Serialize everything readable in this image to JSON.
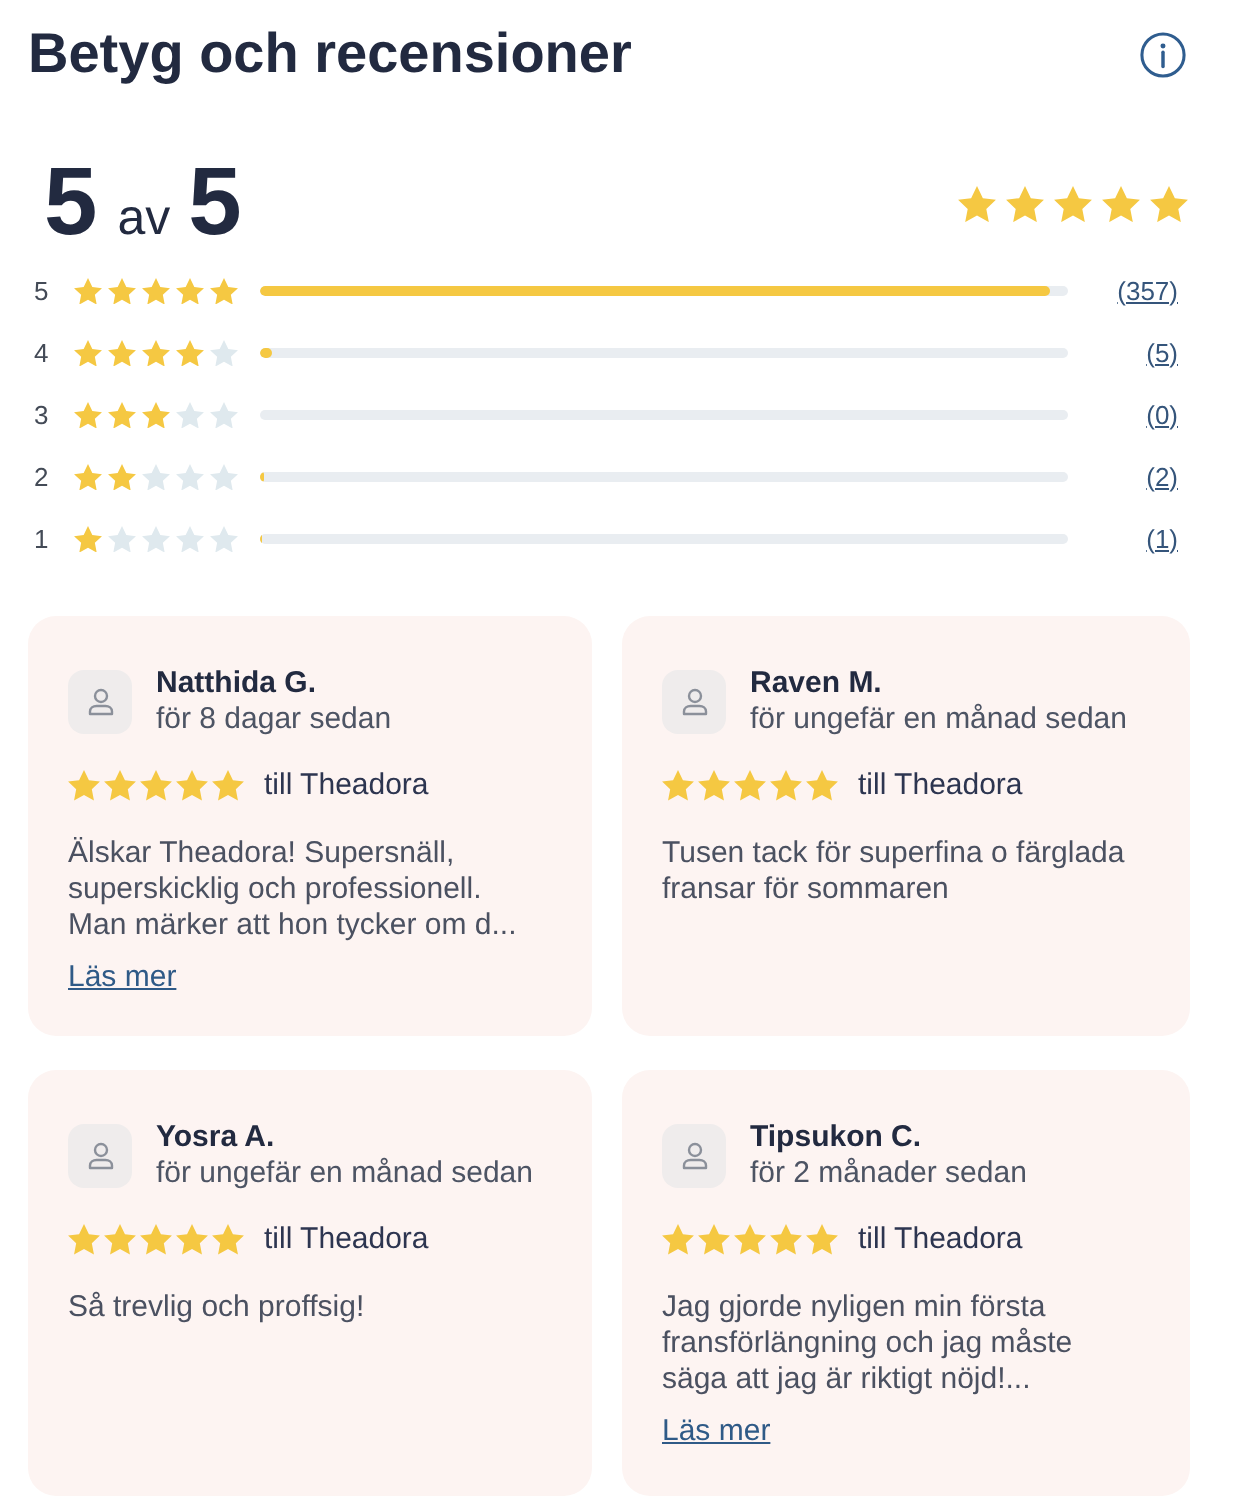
{
  "header": {
    "title": "Betyg och recensioner"
  },
  "summary": {
    "score": "5",
    "of_label": "av",
    "max": "5",
    "stars": 5
  },
  "distribution": [
    {
      "label": "5",
      "stars": 5,
      "level": 0.978,
      "count": "(357)"
    },
    {
      "label": "4",
      "stars": 4,
      "level": 0.015,
      "count": "(5)"
    },
    {
      "label": "3",
      "stars": 3,
      "count": "(0)"
    },
    {
      "label": "2",
      "stars": 2,
      "level": 0.006,
      "count": "(2)"
    },
    {
      "label": "1",
      "stars": 1,
      "level": 0.003,
      "count": "(1)"
    }
  ],
  "reviews": [
    {
      "name": "Natthida G.",
      "time": "för 8 dagar sedan",
      "stars": 5,
      "target": "till Theadora",
      "text": "Älskar Theadora! Supersnäll, superskicklig och professionell. Man märker att hon tycker om d...",
      "read_more": "Läs mer"
    },
    {
      "name": "Raven M.",
      "time": "för ungefär en månad sedan",
      "stars": 5,
      "target": "till Theadora",
      "text": "Tusen tack för superfina o färglada fransar för sommaren"
    },
    {
      "name": "Yosra A.",
      "time": "för ungefär en månad sedan",
      "stars": 5,
      "target": "till Theadora",
      "text": "Så trevlig och proffsig!"
    },
    {
      "name": "Tipsukon C.",
      "time": "för 2 månader sedan",
      "stars": 5,
      "target": "till Theadora",
      "text": "Jag gjorde nyligen min första fransförlängning och jag måste säga att jag är riktigt nöjd!...",
      "read_more": "Läs mer"
    }
  ]
}
